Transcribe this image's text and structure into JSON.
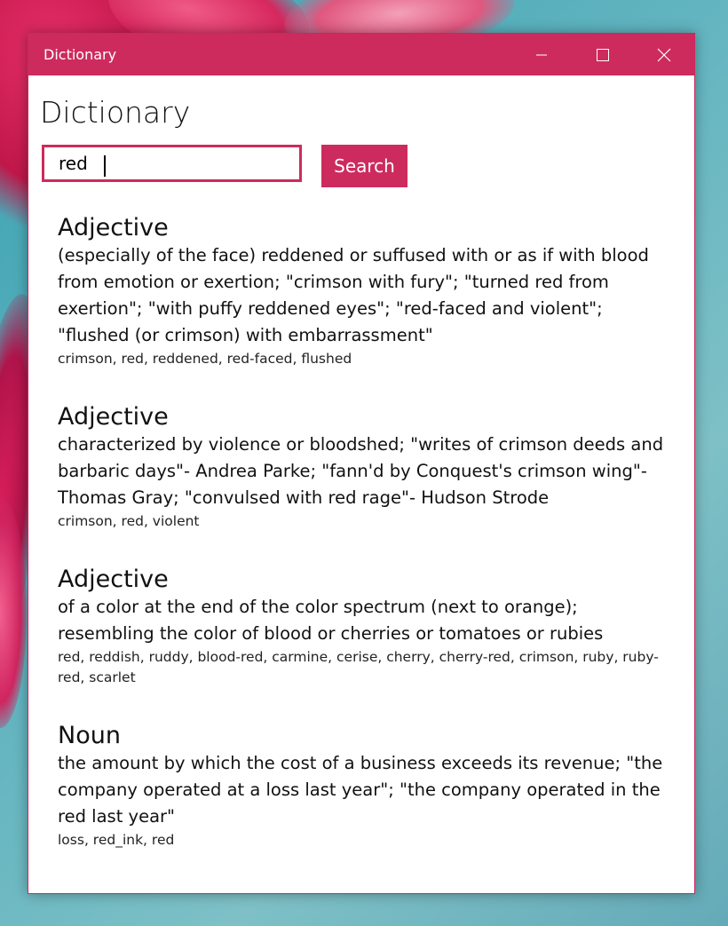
{
  "window": {
    "title": "Dictionary",
    "accent_color": "#cd2b5d"
  },
  "caption_buttons": {
    "minimize_icon": "minimize-icon",
    "maximize_icon": "maximize-icon",
    "close_icon": "close-icon"
  },
  "app": {
    "heading": "Dictionary"
  },
  "search": {
    "value": "red",
    "button_label": "Search"
  },
  "results": [
    {
      "part_of_speech": "Adjective",
      "definition": "(especially of the face) reddened or suffused with or as if with blood from emotion or exertion; \"crimson with fury\"; \"turned red from exertion\"; \"with puffy reddened eyes\"; \"red-faced and violent\"; \"flushed (or crimson) with embarrassment\"",
      "synonyms": "crimson, red, reddened, red-faced, flushed"
    },
    {
      "part_of_speech": "Adjective",
      "definition": "characterized by violence or bloodshed; \"writes of crimson deeds and barbaric days\"- Andrea Parke; \"fann'd by Conquest's crimson wing\"- Thomas Gray; \"convulsed with red rage\"- Hudson Strode",
      "synonyms": "crimson, red, violent"
    },
    {
      "part_of_speech": "Adjective",
      "definition": "of a color at the end of the color spectrum (next to orange); resembling the color of blood or cherries or tomatoes or rubies",
      "synonyms": "red, reddish, ruddy, blood-red, carmine, cerise, cherry, cherry-red, crimson, ruby, ruby-red, scarlet"
    },
    {
      "part_of_speech": "Noun",
      "definition": "the amount by which the cost of a business exceeds its revenue; \"the company operated at a loss last year\"; \"the company operated in the red last year\"",
      "synonyms": "loss, red_ink, red"
    }
  ]
}
